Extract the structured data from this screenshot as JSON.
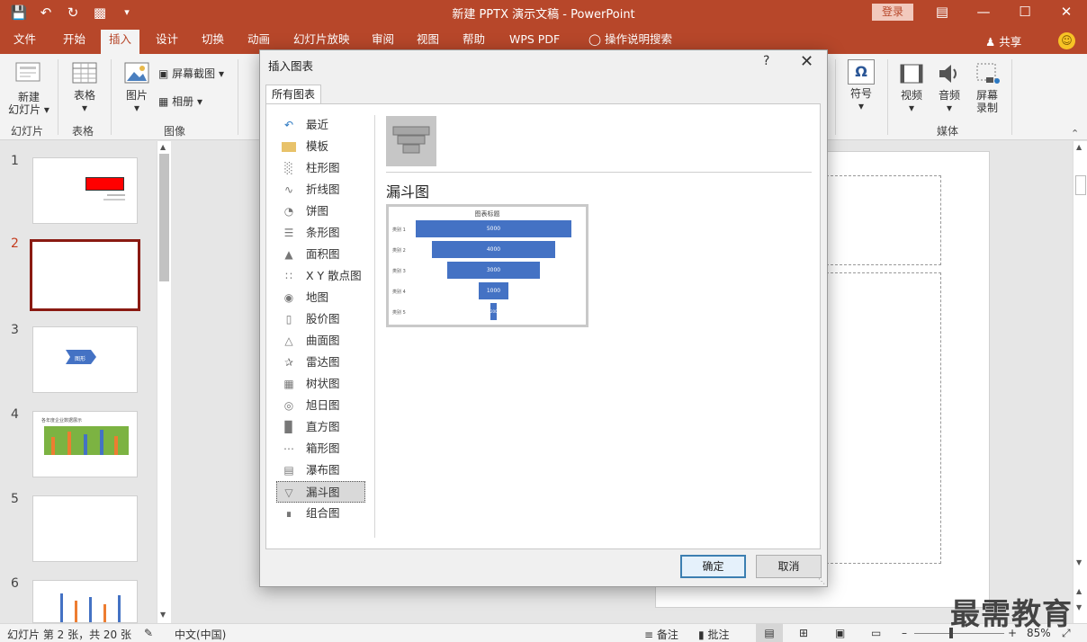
{
  "titlebar": {
    "document_title": "新建 PPTX 演示文稿  -  PowerPoint",
    "login_label": "登录",
    "qat_icons": [
      "save-icon",
      "undo-icon",
      "redo-icon",
      "start-from-beginning-icon",
      "customize-qat-icon"
    ]
  },
  "tabs": {
    "items": [
      "文件",
      "开始",
      "插入",
      "设计",
      "切换",
      "动画",
      "幻灯片放映",
      "审阅",
      "视图",
      "帮助",
      "WPS PDF",
      "操作说明搜索"
    ],
    "active": "插入",
    "share_label": "共享"
  },
  "ribbon": {
    "new_slide": "新建\n幻灯片",
    "new_slide_l1": "新建",
    "new_slide_l2": "幻灯片",
    "group_slides": "幻灯片",
    "table": "表格",
    "group_table": "表格",
    "pictures": "图片",
    "screenshot": "屏幕截图",
    "album": "相册",
    "group_images": "图像",
    "symbol": "符号",
    "video": "视频",
    "audio": "音频",
    "screen_record_l1": "屏幕",
    "screen_record_l2": "录制",
    "group_media": "媒体"
  },
  "slides": {
    "numbers": [
      "1",
      "2",
      "3",
      "4",
      "5",
      "6"
    ],
    "selected": "2",
    "thumb3_text": "图形",
    "thumb4_title": "各年度企业数据展示"
  },
  "dialog": {
    "title": "插入图表",
    "help": "?",
    "tab": "所有图表",
    "categories": [
      {
        "label": "最近",
        "icon": "recent-icon"
      },
      {
        "label": "模板",
        "icon": "folder-icon"
      },
      {
        "label": "柱形图",
        "icon": "column-chart-icon"
      },
      {
        "label": "折线图",
        "icon": "line-chart-icon"
      },
      {
        "label": "饼图",
        "icon": "pie-chart-icon"
      },
      {
        "label": "条形图",
        "icon": "bar-chart-icon"
      },
      {
        "label": "面积图",
        "icon": "area-chart-icon"
      },
      {
        "label": "X Y 散点图",
        "icon": "scatter-chart-icon"
      },
      {
        "label": "地图",
        "icon": "map-chart-icon"
      },
      {
        "label": "股价图",
        "icon": "stock-chart-icon"
      },
      {
        "label": "曲面图",
        "icon": "surface-chart-icon"
      },
      {
        "label": "雷达图",
        "icon": "radar-chart-icon"
      },
      {
        "label": "树状图",
        "icon": "treemap-chart-icon"
      },
      {
        "label": "旭日图",
        "icon": "sunburst-chart-icon"
      },
      {
        "label": "直方图",
        "icon": "histogram-chart-icon"
      },
      {
        "label": "箱形图",
        "icon": "box-whisker-chart-icon"
      },
      {
        "label": "瀑布图",
        "icon": "waterfall-chart-icon"
      },
      {
        "label": "漏斗图",
        "icon": "funnel-chart-icon"
      },
      {
        "label": "组合图",
        "icon": "combo-chart-icon"
      }
    ],
    "selected_category": "漏斗图",
    "type_title": "漏斗图",
    "preview": {
      "title": "图表标题",
      "values": [
        "5000",
        "4000",
        "3000",
        "1000",
        "200"
      ],
      "categories": [
        "类别 1",
        "类别 2",
        "类别 3",
        "类别 4",
        "类别 5"
      ]
    },
    "ok_label": "确定",
    "cancel_label": "取消"
  },
  "statusbar": {
    "slide_info": "幻灯片 第 2 张，共 20 张",
    "language": "中文(中国)",
    "notes_label": "备注",
    "comments_label": "批注",
    "zoom": "85%"
  },
  "watermark": "最需教育",
  "colors": {
    "accent": "#b7472a",
    "funnel_bar": "#4472c4",
    "selected_thumb_border": "#8a1a12"
  }
}
